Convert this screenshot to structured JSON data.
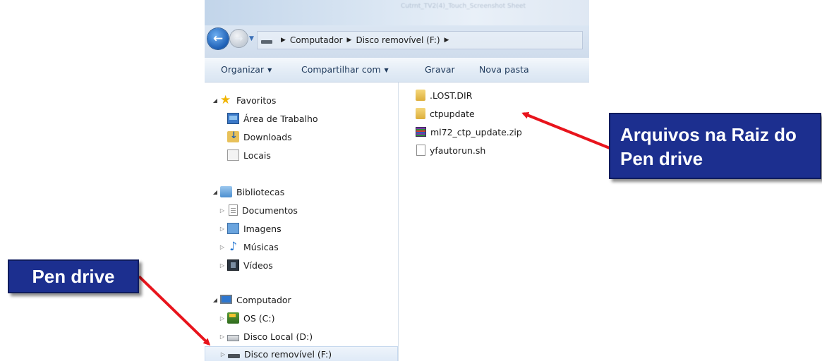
{
  "address_bar": {
    "segments": [
      "Computador",
      "Disco removível (F:)"
    ]
  },
  "toolbar": {
    "organize": "Organizar",
    "share": "Compartilhar com",
    "burn": "Gravar",
    "new_folder": "Nova pasta"
  },
  "nav": {
    "favorites": {
      "label": "Favoritos",
      "items": [
        "Área de Trabalho",
        "Downloads",
        "Locais"
      ]
    },
    "libraries": {
      "label": "Bibliotecas",
      "items": [
        "Documentos",
        "Imagens",
        "Músicas",
        "Vídeos"
      ]
    },
    "computer": {
      "label": "Computador",
      "items": [
        "OS (C:)",
        "Disco Local (D:)",
        "Disco removível (F:)"
      ],
      "selected": "Disco removível (F:)"
    }
  },
  "files": [
    {
      "name": ".LOST.DIR",
      "icon": "folder-icon"
    },
    {
      "name": "ctpupdate",
      "icon": "folder-icon"
    },
    {
      "name": "ml72_ctp_update.zip",
      "icon": "zip-archive-icon"
    },
    {
      "name": "yfautorun.sh",
      "icon": "file-icon"
    }
  ],
  "callouts": {
    "root_files": "Arquivos na Raiz do Pen drive",
    "pen_drive": "Pen drive"
  },
  "colors": {
    "callout_bg": "#1c2f8f",
    "arrow": "#e8141c",
    "selection": "#dfeaf7"
  }
}
